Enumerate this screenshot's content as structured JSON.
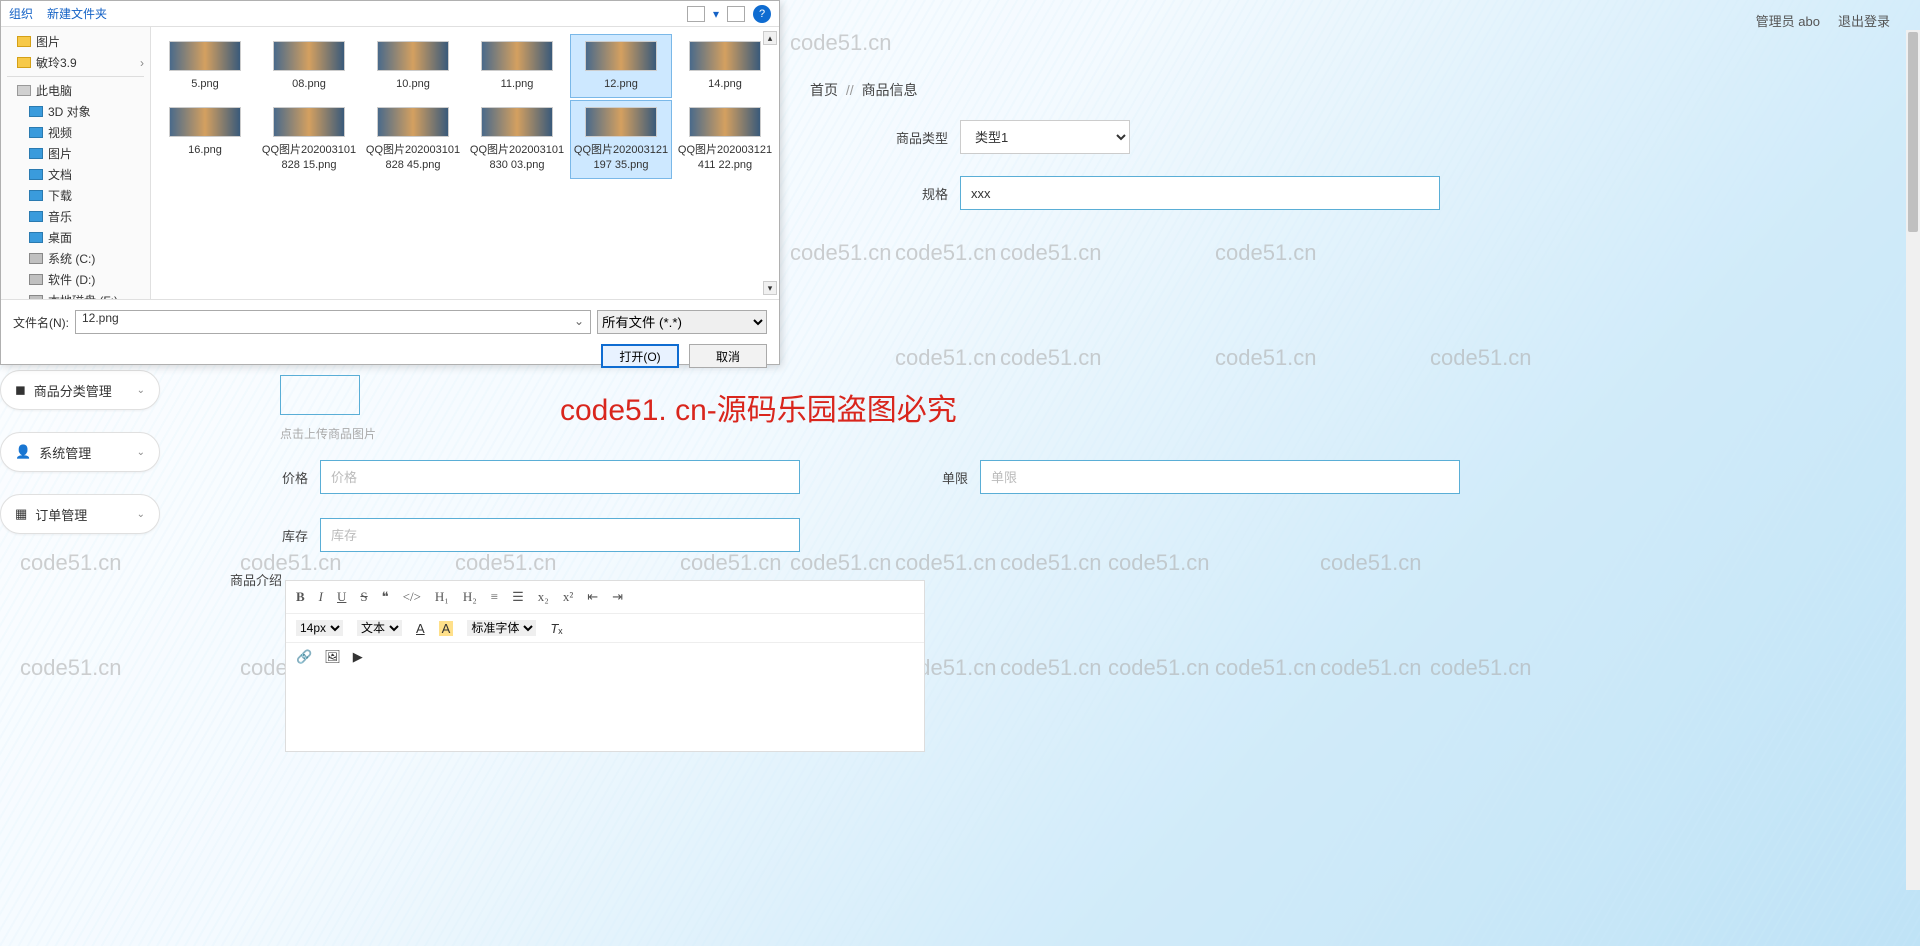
{
  "header": {
    "user_label": "管理员 abo",
    "logout": "退出登录"
  },
  "breadcrumb": {
    "home": "首页",
    "sep": "//",
    "current": "商品信息"
  },
  "sidebar": {
    "items": [
      {
        "icon": "category-icon",
        "label": "商品分类管理"
      },
      {
        "icon": "user-icon",
        "label": "系统管理"
      },
      {
        "icon": "grid-icon",
        "label": "订单管理"
      }
    ]
  },
  "form": {
    "type_label": "商品类型",
    "type_value": "类型1",
    "spec_label": "规格",
    "spec_value": "xxx",
    "upload_hint": "点击上传商品图片",
    "price_label": "价格",
    "price_placeholder": "价格",
    "stock_label": "库存",
    "stock_placeholder": "库存",
    "limit_label": "单限",
    "limit_placeholder": "单限",
    "intro_label": "商品介绍"
  },
  "editor": {
    "font_size": "14px",
    "font_type": "文本",
    "font_family": "标准字体"
  },
  "dialog": {
    "organize": "组织",
    "new_folder": "新建文件夹",
    "help": "?",
    "tree": [
      {
        "label": "图片",
        "icon": "ico-folder",
        "indent": false
      },
      {
        "label": "敏玲3.9",
        "icon": "ico-folder",
        "indent": false,
        "expand": true
      },
      {
        "label": "此电脑",
        "icon": "ico-pc",
        "indent": false,
        "hr_before": true
      },
      {
        "label": "3D 对象",
        "icon": "ico-blue",
        "indent": true
      },
      {
        "label": "视频",
        "icon": "ico-blue",
        "indent": true
      },
      {
        "label": "图片",
        "icon": "ico-blue",
        "indent": true
      },
      {
        "label": "文档",
        "icon": "ico-blue",
        "indent": true
      },
      {
        "label": "下载",
        "icon": "ico-blue",
        "indent": true
      },
      {
        "label": "音乐",
        "icon": "ico-blue",
        "indent": true
      },
      {
        "label": "桌面",
        "icon": "ico-blue",
        "indent": true
      },
      {
        "label": "系统 (C:)",
        "icon": "ico-drive",
        "indent": true
      },
      {
        "label": "软件 (D:)",
        "icon": "ico-drive",
        "indent": true
      },
      {
        "label": "本地磁盘 (F:)",
        "icon": "ico-drive",
        "indent": true
      }
    ],
    "files": [
      {
        "name": "5.png"
      },
      {
        "name": "08.png"
      },
      {
        "name": "10.png"
      },
      {
        "name": "11.png"
      },
      {
        "name": "12.png",
        "selected": true
      },
      {
        "name": "14.png"
      },
      {
        "name": "16.png"
      },
      {
        "name": "QQ图片202003101828 15.png"
      },
      {
        "name": "QQ图片202003101828 45.png"
      },
      {
        "name": "QQ图片202003101830 03.png"
      },
      {
        "name": "QQ图片202003121197 35.png",
        "selected": true
      },
      {
        "name": "QQ图片202003121411 22.png"
      }
    ],
    "filename_label": "文件名(N):",
    "filename_value": "12.png",
    "filter": "所有文件 (*.*)",
    "open": "打开(O)",
    "cancel": "取消"
  },
  "watermark": {
    "text": "code51.cn",
    "center": "code51. cn-源码乐园盗图必究"
  }
}
